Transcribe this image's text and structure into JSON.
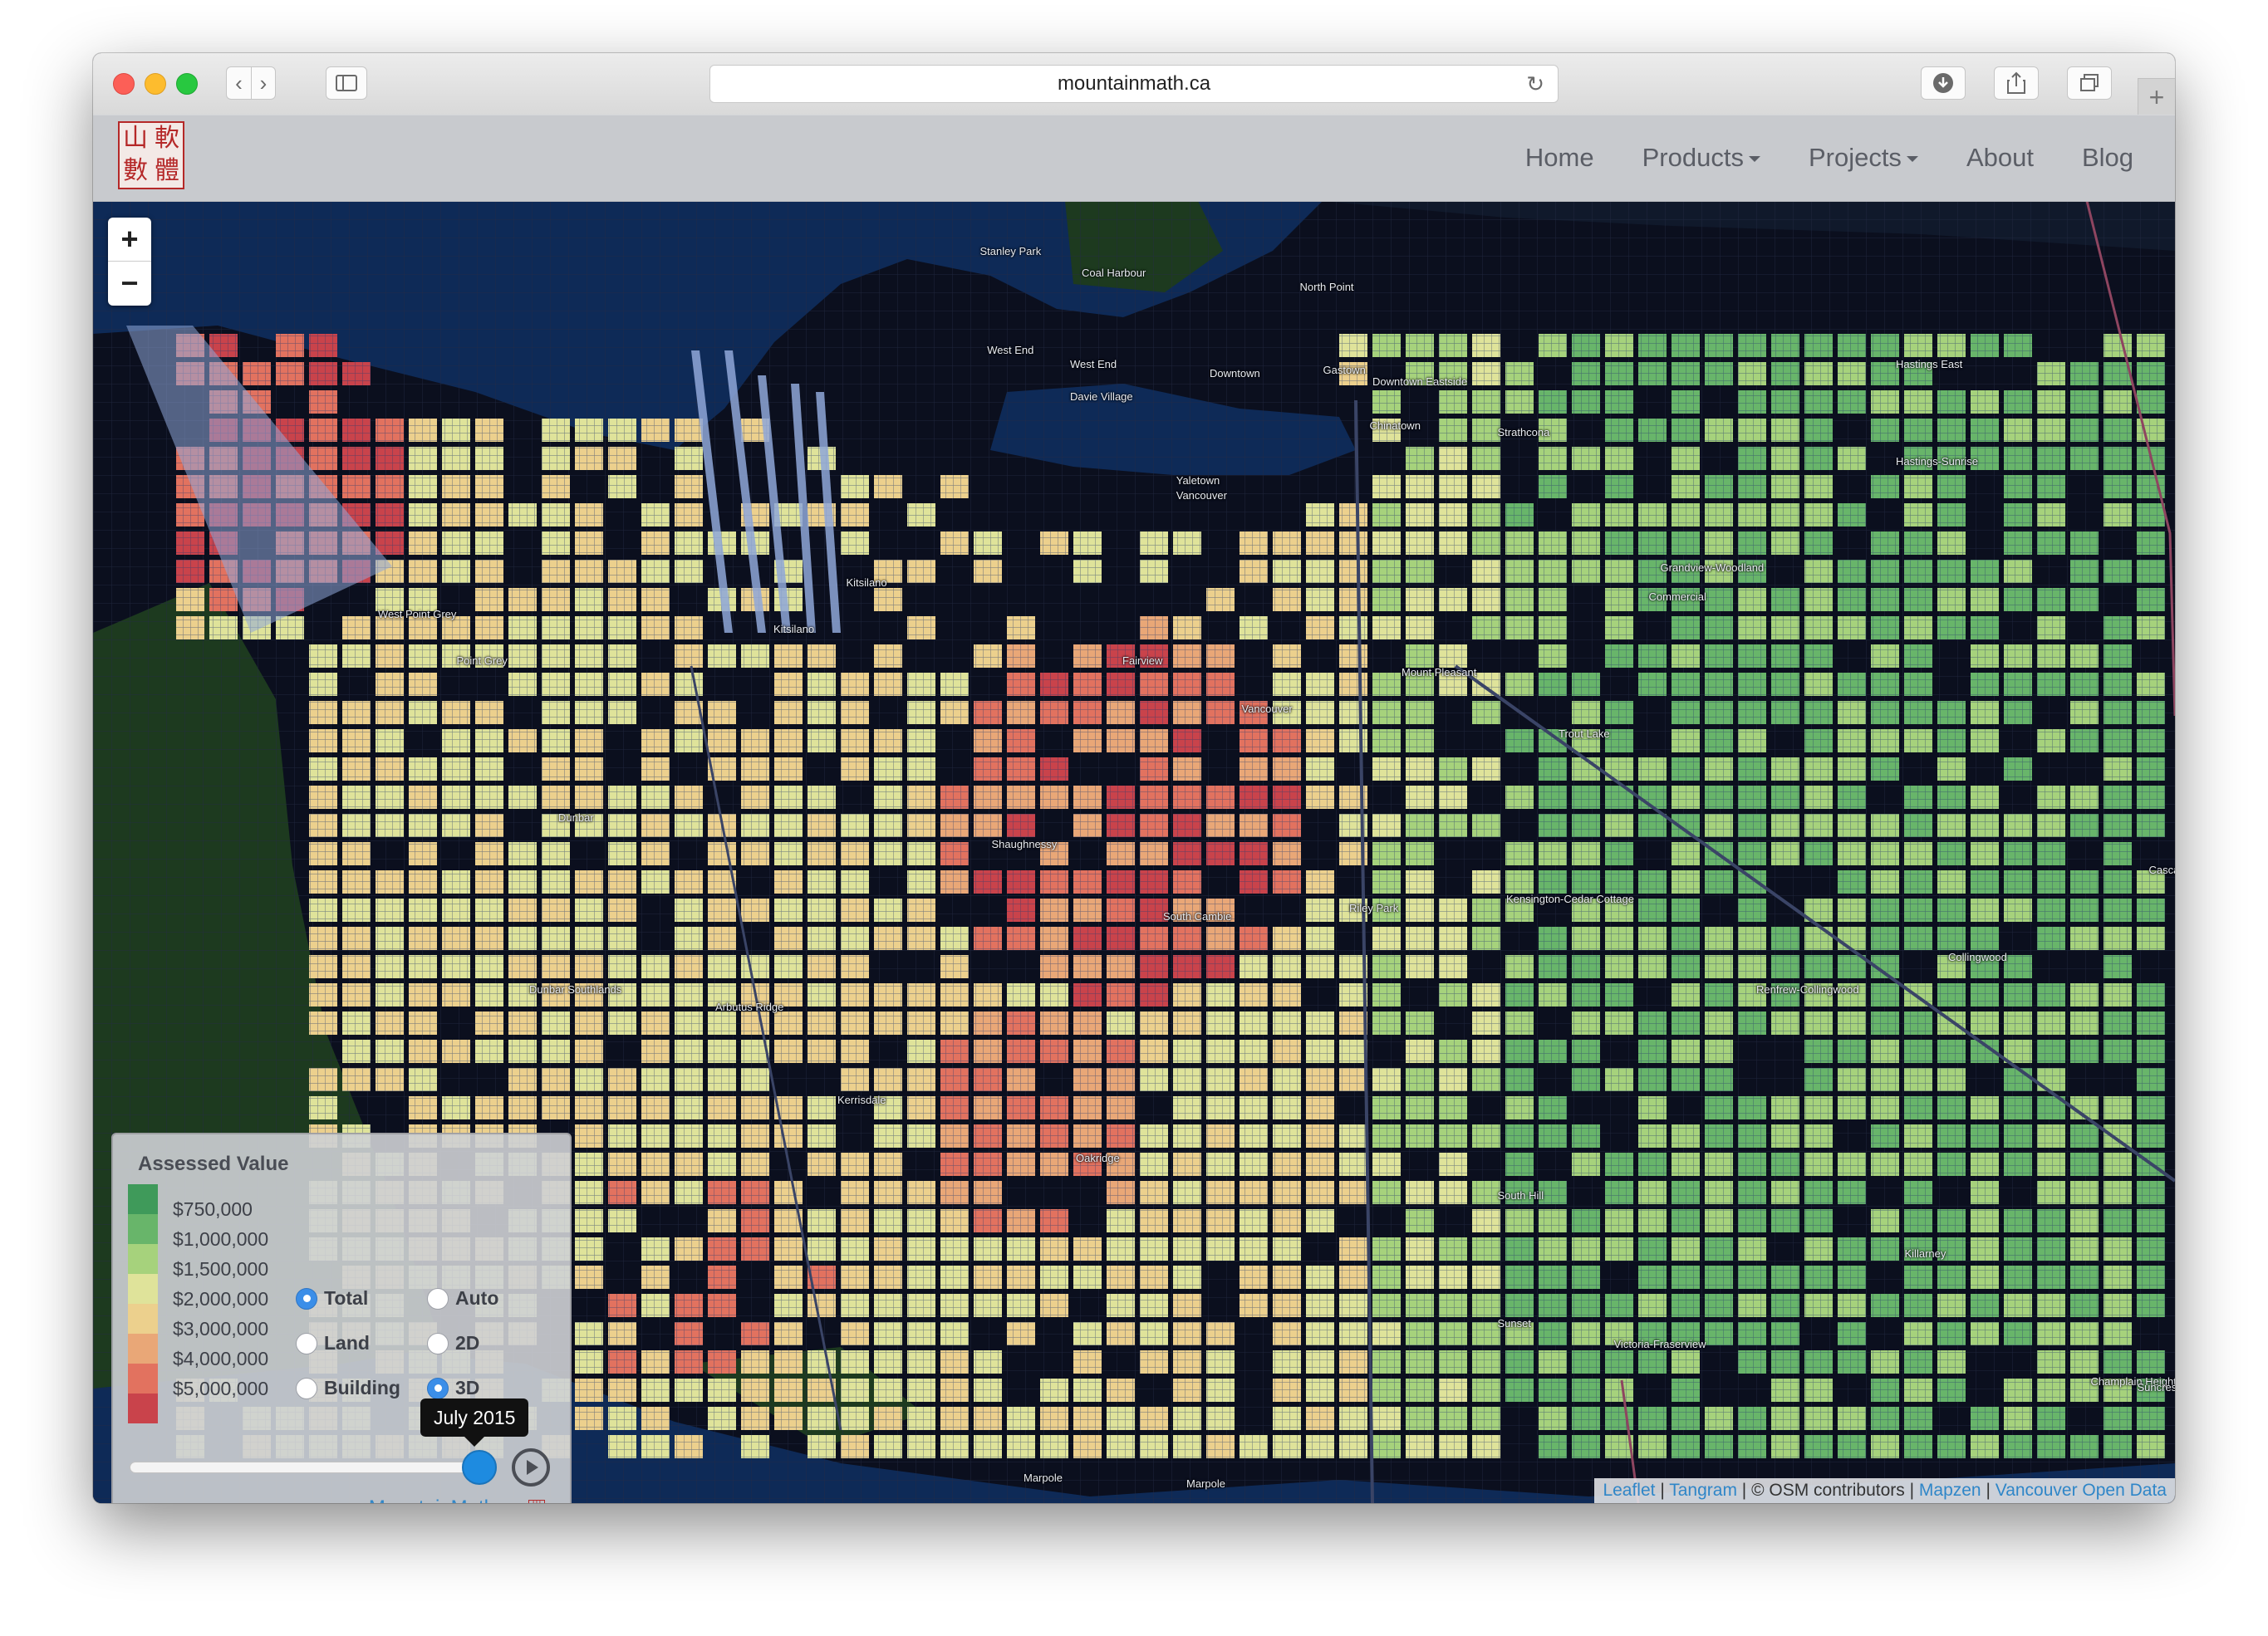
{
  "browser": {
    "url": "mountainmath.ca",
    "nav_back": "‹",
    "nav_forward": "›",
    "new_tab": "+"
  },
  "site": {
    "logo_chars": [
      "山",
      "軟",
      "數",
      "體"
    ],
    "nav": [
      {
        "label": "Home",
        "dropdown": false
      },
      {
        "label": "Products",
        "dropdown": true
      },
      {
        "label": "Projects",
        "dropdown": true
      },
      {
        "label": "About",
        "dropdown": false
      },
      {
        "label": "Blog",
        "dropdown": false
      }
    ]
  },
  "map": {
    "zoom_in": "+",
    "zoom_out": "−",
    "labels": [
      "Stanley Park",
      "Coal Harbour",
      "North Point",
      "West End",
      "West End",
      "Davie Village",
      "Downtown",
      "Gastown",
      "Downtown Eastside",
      "Chinatown",
      "Strathcona",
      "Hastings East",
      "Hastings-Sunrise",
      "Yaletown",
      "Vancouver",
      "Kitsilano",
      "Kitsilano",
      "West Point Grey",
      "Point Grey",
      "Grandview-Woodland",
      "Commercial",
      "Fairview",
      "Mount Pleasant",
      "Vancouver",
      "Trout Lake",
      "Dunbar",
      "Shaughnessy",
      "South Cambie",
      "Riley Park",
      "Kensington-Cedar Cottage",
      "Collingwood",
      "Renfrew-Collingwood",
      "Dunbar Southlands",
      "Arbutus Ridge",
      "Kerrisdale",
      "Oakridge",
      "South Hill",
      "Killarney",
      "Sunset",
      "Victoria-Fraserview",
      "Champlain Heights",
      "Suncrest",
      "Marpole",
      "Marpole",
      "Cascade"
    ],
    "colors": {
      "water": "#0e2a57",
      "land": "#0b0f1e",
      "park": "#1d3a1f"
    }
  },
  "legend": {
    "title": "Assessed Value",
    "values": [
      "$750,000",
      "$1,000,000",
      "$1,500,000",
      "$2,000,000",
      "$3,000,000",
      "$4,000,000",
      "$5,000,000"
    ],
    "swatch_colors": [
      "#3f9a5a",
      "#68b56a",
      "#a6d27c",
      "#dfe39a",
      "#ecd08d",
      "#e9a777",
      "#e2725f",
      "#c9434b"
    ],
    "mode_options": [
      {
        "label": "Total",
        "selected": true
      },
      {
        "label": "Land",
        "selected": false
      },
      {
        "label": "Building",
        "selected": false
      }
    ],
    "view_options": [
      {
        "label": "Auto",
        "selected": false
      },
      {
        "label": "2D",
        "selected": false
      },
      {
        "label": "3D",
        "selected": true
      }
    ],
    "date_tooltip": "July 2015",
    "slider_value": 1.0,
    "credit": "MountainMath.ca"
  },
  "attribution": {
    "leaflet": "Leaflet",
    "sep1": " | ",
    "tangram": "Tangram",
    "osm": " | © OSM contributors | ",
    "mapzen": "Mapzen",
    "sep2": " | ",
    "open_data": "Vancouver Open Data"
  }
}
